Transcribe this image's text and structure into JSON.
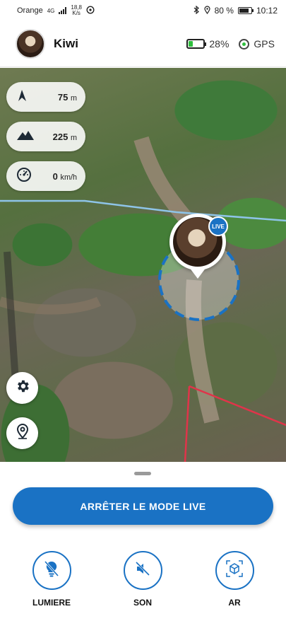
{
  "status_bar": {
    "carrier": "Orange",
    "network_type": "4G",
    "net_speed_value": "18,8",
    "net_speed_unit": "K/s",
    "battery_percent": "80 %",
    "time": "10:12"
  },
  "header": {
    "pet_name": "Kiwi",
    "tracker_battery": "28%",
    "tracker_battery_level": 0.28,
    "gps_label": "GPS"
  },
  "map": {
    "metrics": {
      "distance_value": "75",
      "distance_unit": "m",
      "altitude_value": "225",
      "altitude_unit": "m",
      "speed_value": "0",
      "speed_unit": "km/h"
    },
    "live_badge": "LIVE"
  },
  "sheet": {
    "stop_live_label": "ARRÊTER LE MODE LIVE",
    "controls": {
      "light_label": "LUMIERE",
      "sound_label": "SON",
      "ar_label": "AR"
    }
  },
  "colors": {
    "primary": "#1a72c4",
    "battery_green": "#2fbf3e",
    "geofence_red": "#e0344a",
    "trail_blue": "#8ec4e8"
  }
}
